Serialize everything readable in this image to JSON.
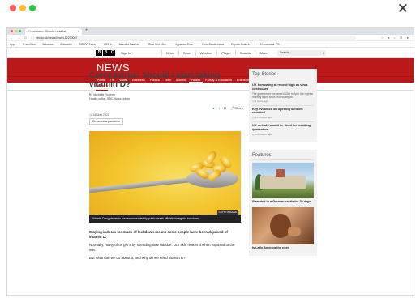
{
  "window": {
    "close_glyph": "✕",
    "dot_colors": [
      "#ff5f57",
      "#febc2e",
      "#28c840"
    ]
  },
  "browser": {
    "tab_title": "Coronavirus: Should I start tak...",
    "tab_close": "×",
    "new_tab": "+",
    "nav_glyphs": "← → C ⌂",
    "url": "bbc.co.uk/news/health-52270067",
    "ext_glyphs": "☆ ● ♪ ☰ ●",
    "bookmarks": [
      "Apps",
      "B and Few",
      "Behance",
      "Wikimedia",
      "SPLOO Extras",
      "WEB.b",
      "Beautiful Free Ho...",
      "Pixel Grid | Pro...",
      "Appstorm Rum...",
      "Color Palette Ideas",
      "Popular Fonts b...",
      "UI Movement - Th..."
    ]
  },
  "bbc": {
    "logo_letters": [
      "B",
      "B",
      "C"
    ],
    "sign_in": "Sign in",
    "bell_icon": "bell-icon",
    "top_nav": [
      "News",
      "Sport",
      "Weather",
      "iPlayer",
      "Sounds",
      "More"
    ],
    "search_placeholder": "Search",
    "search_glyph": "⌕",
    "news_title": "NEWS",
    "section_nav": [
      "Home",
      "UK",
      "World",
      "Business",
      "Politics",
      "Tech",
      "Science",
      "Health",
      "Family & Education",
      "Entertainment & Arts",
      "Stories",
      "More ▾"
    ],
    "active_section": "Health",
    "sub_label": "Health"
  },
  "article": {
    "headline": "Coronavirus: Should I start taking vitamin D?",
    "byline_name": "By Michelle Roberts",
    "byline_role": "Health editor, BBC News online",
    "date": "14 May 2020",
    "share_label": "Share",
    "share_glyphs": [
      "f",
      "●",
      "t",
      "✉"
    ],
    "tag": "Coronavirus pandemic",
    "image_credit": "GETTY IMAGES",
    "image_caption": "Vitamin D supplements are recommended by public health officials during the lockdown",
    "paragraphs": [
      "Staying indoors for much of lockdown means some people have been deprived of vitamin D.",
      "Normally, many of us get it by spending time outside. Our skin makes it when exposed to the sun.",
      "But what can we do about it, and why do we need vitamin D?"
    ]
  },
  "sidebar": {
    "top_stories_title": "Top Stories",
    "stories": [
      {
        "title": "UK borrowing at record high as virus cost soars",
        "summary": "The government borrowed £62bn in April, the highest monthly figure since records began.",
        "time": "4 hours ago"
      },
      {
        "title": "Key evidence on opening schools revealed",
        "summary": "",
        "time": "24 minutes ago"
      },
      {
        "title": "UK arrivals would be fined for breaking quarantine",
        "summary": "",
        "time": "56 minutes ago"
      }
    ],
    "features_title": "Features",
    "features": [
      {
        "caption": "Stranded in a German castle for 70 days"
      },
      {
        "caption": "Is Latin America the next"
      }
    ]
  },
  "colors": {
    "bbc_red": "#bb1919",
    "headline": "#3f3f42"
  }
}
